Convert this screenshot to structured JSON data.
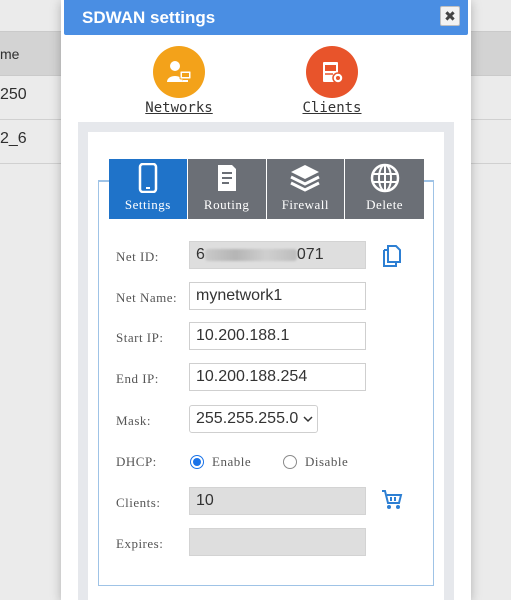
{
  "background": {
    "header": "me",
    "rows": [
      "250",
      "2_6"
    ]
  },
  "dialog": {
    "title": "SDWAN settings",
    "close_glyph": "✖"
  },
  "top_nav": [
    {
      "label": "Networks",
      "icon": "networks-icon",
      "color": "#f3a21a"
    },
    {
      "label": "Clients",
      "icon": "clients-icon",
      "color": "#e8542b"
    }
  ],
  "tabs": [
    {
      "label": "Settings",
      "icon": "phone-icon",
      "active": true
    },
    {
      "label": "Routing",
      "icon": "document-icon",
      "active": false
    },
    {
      "label": "Firewall",
      "icon": "layers-icon",
      "active": false
    },
    {
      "label": "Delete",
      "icon": "globe-icon",
      "active": false
    }
  ],
  "form": {
    "net_id": {
      "label": "Net ID:",
      "value_prefix": "6",
      "value_suffix": "071"
    },
    "net_name": {
      "label": "Net Name:",
      "value": "mynetwork1"
    },
    "start_ip": {
      "label": "Start IP:",
      "value": "10.200.188.1"
    },
    "end_ip": {
      "label": "End IP:",
      "value": "10.200.188.254"
    },
    "mask": {
      "label": "Mask:",
      "value": "255.255.255.0"
    },
    "dhcp": {
      "label": "DHCP:",
      "options": [
        "Enable",
        "Disable"
      ],
      "selected": "Enable"
    },
    "clients": {
      "label": "Clients:",
      "value": "10"
    },
    "expires": {
      "label": "Expires:",
      "value": ""
    }
  },
  "colors": {
    "accent": "#1f73c9",
    "titlebar": "#4a8ee3",
    "tab_inactive": "#6b6f76"
  }
}
